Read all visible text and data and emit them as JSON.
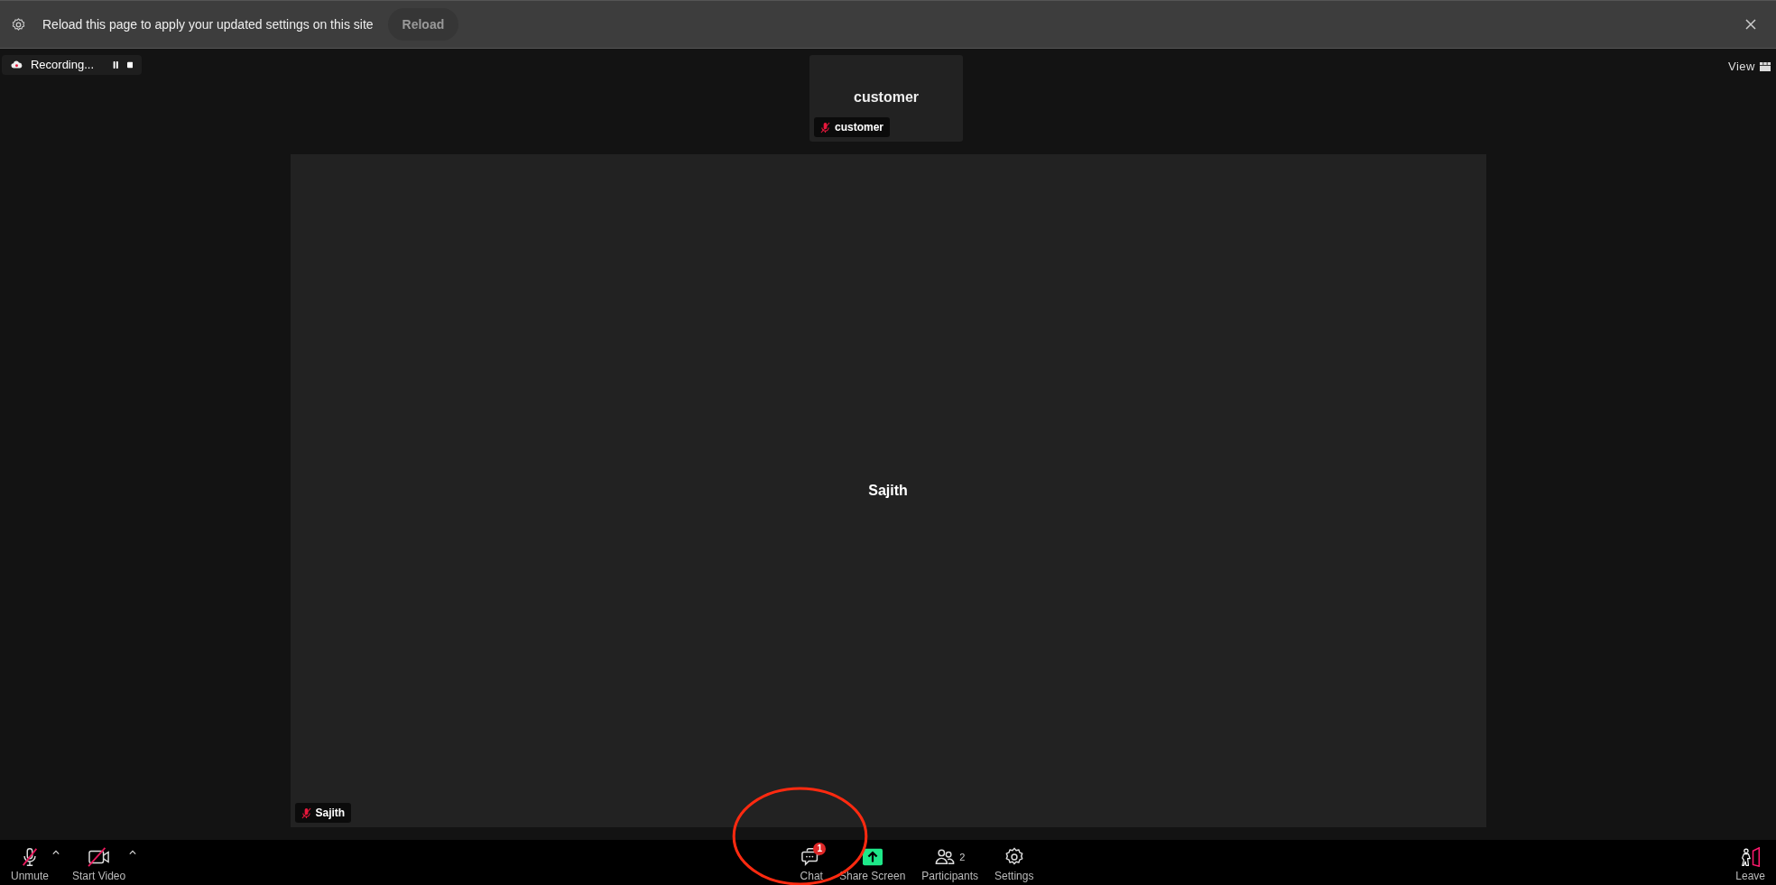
{
  "banner": {
    "message": "Reload this page to apply your updated settings on this site",
    "button": "Reload"
  },
  "recording": {
    "label": "Recording..."
  },
  "view_button": {
    "label": "View"
  },
  "thumbnail": {
    "name": "customer",
    "tag": "customer",
    "muted": true
  },
  "main_video": {
    "name": "Sajith",
    "tag": "Sajith",
    "muted": true
  },
  "toolbar": {
    "left": [
      {
        "kind": "mic",
        "label": "Unmute",
        "off": true,
        "menu": true
      },
      {
        "kind": "video",
        "label": "Start Video",
        "off": true,
        "menu": true
      }
    ],
    "center": [
      {
        "kind": "chat",
        "label": "Chat",
        "badge": "1"
      },
      {
        "kind": "share",
        "label": "Share Screen"
      },
      {
        "kind": "participants",
        "label": "Participants",
        "count": "2"
      },
      {
        "kind": "settings",
        "label": "Settings"
      }
    ],
    "right": [
      {
        "kind": "leave",
        "label": "Leave"
      }
    ]
  }
}
